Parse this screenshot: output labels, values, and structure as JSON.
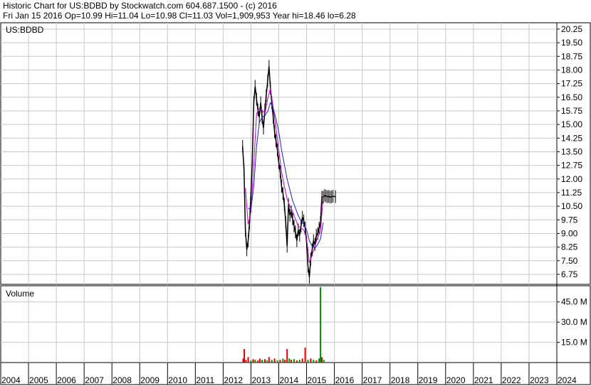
{
  "header": {
    "line1": "Historic Chart for US:BDBD by Stockwatch.com 604.687.1500 - (c) 2016",
    "line2": "Fri Jan 15 2016   Op=10.99   Hi=11.04   Lo=10.98   Cl=11.03   Vol=1,909,953   Year hi=18.46   lo=6.28"
  },
  "chart_data": [
    {
      "type": "line",
      "title": "US:BDBD",
      "y_ticks": [
        "20.25",
        "19.50",
        "18.75",
        "18.00",
        "17.25",
        "16.50",
        "15.75",
        "15.00",
        "14.25",
        "13.50",
        "12.75",
        "12.00",
        "11.25",
        "10.50",
        "9.75",
        "9.00",
        "8.25",
        "7.50",
        "6.75"
      ],
      "ylim": [
        6.2,
        20.6
      ],
      "x_ticks": [
        "2004",
        "2005",
        "2006",
        "2007",
        "2008",
        "2009",
        "2010",
        "2011",
        "2012",
        "2013",
        "2014",
        "2015",
        "2016",
        "2017",
        "2018",
        "2019",
        "2020",
        "2021",
        "2022",
        "2023",
        "2024"
      ],
      "xlim": [
        2004,
        2024
      ],
      "grid": true,
      "series": [
        {
          "style": "price",
          "color": "#000000",
          "x": [
            2012.7,
            2012.75,
            2012.8,
            2012.85,
            2012.9,
            2012.95,
            2013.0,
            2013.05,
            2013.1,
            2013.15,
            2013.2,
            2013.25,
            2013.3,
            2013.35,
            2013.4,
            2013.45,
            2013.5,
            2013.55,
            2013.6,
            2013.65,
            2013.7,
            2013.75,
            2013.8,
            2013.85,
            2013.9,
            2013.95,
            2014.0,
            2014.05,
            2014.1,
            2014.15,
            2014.2,
            2014.25,
            2014.3,
            2014.35,
            2014.4,
            2014.45,
            2014.5,
            2014.55,
            2014.6,
            2014.65,
            2014.7,
            2014.75,
            2014.8,
            2014.85,
            2014.9,
            2014.95,
            2015.0,
            2015.05,
            2015.1,
            2015.15,
            2015.2,
            2015.25,
            2015.3,
            2015.35,
            2015.4,
            2015.45,
            2015.5,
            2015.55,
            2015.6,
            2015.65,
            2015.7,
            2015.75,
            2015.8,
            2015.85,
            2015.9,
            2015.95,
            2016.04
          ],
          "values": [
            13.8,
            12.5,
            9.2,
            8.1,
            8.6,
            9.6,
            11.2,
            13.1,
            16.2,
            17.1,
            16.4,
            15.8,
            15.4,
            16.2,
            15.4,
            14.8,
            15.8,
            16.6,
            17.4,
            18.2,
            17.0,
            16.2,
            15.4,
            14.6,
            14.1,
            13.6,
            12.9,
            12.4,
            11.6,
            11.2,
            10.6,
            9.6,
            8.3,
            10.6,
            10.0,
            10.2,
            9.8,
            9.4,
            9.1,
            8.6,
            9.2,
            8.9,
            9.4,
            9.9,
            9.7,
            9.3,
            8.5,
            7.2,
            6.6,
            7.6,
            8.1,
            8.6,
            8.4,
            8.9,
            9.0,
            9.3,
            9.6,
            11.0,
            11.0,
            11.1,
            11.05,
            11.03,
            11.04,
            11.0,
            11.02,
            11.05,
            11.03
          ]
        },
        {
          "style": "moving-average",
          "color": "#c000c0",
          "x": [
            2012.8,
            2012.9,
            2013.0,
            2013.1,
            2013.2,
            2013.3,
            2013.4,
            2013.5,
            2013.6,
            2013.7,
            2013.8,
            2013.9,
            2014.0,
            2014.1,
            2014.2,
            2014.3,
            2014.4,
            2014.5,
            2014.6,
            2014.7,
            2014.8,
            2014.9,
            2015.0,
            2015.1,
            2015.2,
            2015.3,
            2015.4,
            2015.5,
            2015.6
          ],
          "values": [
            11.5,
            9.5,
            10.2,
            12.8,
            15.6,
            15.9,
            15.8,
            15.6,
            16.4,
            17.0,
            15.9,
            14.8,
            13.6,
            12.4,
            11.6,
            10.9,
            10.5,
            10.2,
            9.8,
            9.4,
            9.3,
            9.2,
            8.7,
            7.4,
            7.8,
            8.3,
            8.8,
            9.1,
            11.1
          ]
        },
        {
          "style": "moving-average",
          "color": "#2020d0",
          "x": [
            2012.9,
            2013.0,
            2013.1,
            2013.2,
            2013.3,
            2013.4,
            2013.5,
            2013.6,
            2013.7,
            2013.8,
            2013.9,
            2014.0,
            2014.1,
            2014.2,
            2014.3,
            2014.4,
            2014.5,
            2014.6,
            2014.7,
            2014.8,
            2014.9,
            2015.0,
            2015.1,
            2015.2,
            2015.3,
            2015.4,
            2015.5,
            2015.6
          ],
          "values": [
            10.4,
            10.3,
            11.6,
            13.8,
            15.1,
            15.4,
            15.5,
            15.7,
            16.2,
            15.9,
            15.3,
            14.6,
            13.6,
            12.8,
            12.0,
            11.4,
            10.8,
            10.4,
            10.0,
            9.7,
            9.5,
            9.2,
            8.6,
            8.3,
            8.2,
            8.4,
            8.7,
            9.6
          ]
        }
      ]
    },
    {
      "type": "bar",
      "title": "Volume",
      "y_ticks": [
        "45.0 M",
        "30.0 M",
        "15.0 M"
      ],
      "ylim": [
        0,
        57
      ],
      "grid": true,
      "bars": [
        {
          "x": 2012.72,
          "v": 3,
          "c": "#e00000"
        },
        {
          "x": 2012.76,
          "v": 10,
          "c": "#e00000"
        },
        {
          "x": 2012.82,
          "v": 2,
          "c": "#e00000"
        },
        {
          "x": 2012.9,
          "v": 4,
          "c": "#e00000"
        },
        {
          "x": 2013.0,
          "v": 1.5,
          "c": "#009000"
        },
        {
          "x": 2013.08,
          "v": 2.5,
          "c": "#e00000"
        },
        {
          "x": 2013.15,
          "v": 2,
          "c": "#009000"
        },
        {
          "x": 2013.25,
          "v": 1.5,
          "c": "#e00000"
        },
        {
          "x": 2013.32,
          "v": 3,
          "c": "#e00000"
        },
        {
          "x": 2013.4,
          "v": 2,
          "c": "#009000"
        },
        {
          "x": 2013.5,
          "v": 2.5,
          "c": "#e00000"
        },
        {
          "x": 2013.58,
          "v": 1.5,
          "c": "#009000"
        },
        {
          "x": 2013.65,
          "v": 4,
          "c": "#e00000"
        },
        {
          "x": 2013.75,
          "v": 2,
          "c": "#009000"
        },
        {
          "x": 2013.85,
          "v": 3,
          "c": "#e00000"
        },
        {
          "x": 2013.95,
          "v": 1.5,
          "c": "#009000"
        },
        {
          "x": 2014.05,
          "v": 2,
          "c": "#e00000"
        },
        {
          "x": 2014.15,
          "v": 3,
          "c": "#009000"
        },
        {
          "x": 2014.22,
          "v": 2,
          "c": "#e00000"
        },
        {
          "x": 2014.3,
          "v": 10,
          "c": "#e00000"
        },
        {
          "x": 2014.38,
          "v": 3,
          "c": "#009000"
        },
        {
          "x": 2014.45,
          "v": 2,
          "c": "#e00000"
        },
        {
          "x": 2014.55,
          "v": 2.5,
          "c": "#009000"
        },
        {
          "x": 2014.65,
          "v": 1.5,
          "c": "#e00000"
        },
        {
          "x": 2014.75,
          "v": 2,
          "c": "#009000"
        },
        {
          "x": 2014.85,
          "v": 3,
          "c": "#e00000"
        },
        {
          "x": 2014.95,
          "v": 11,
          "c": "#e00000"
        },
        {
          "x": 2015.05,
          "v": 2,
          "c": "#009000"
        },
        {
          "x": 2015.15,
          "v": 3,
          "c": "#e00000"
        },
        {
          "x": 2015.25,
          "v": 2,
          "c": "#009000"
        },
        {
          "x": 2015.35,
          "v": 1.5,
          "c": "#e00000"
        },
        {
          "x": 2015.45,
          "v": 3,
          "c": "#009000"
        },
        {
          "x": 2015.5,
          "v": 56,
          "c": "#009000"
        },
        {
          "x": 2015.55,
          "v": 4,
          "c": "#e00000"
        },
        {
          "x": 2015.62,
          "v": 2,
          "c": "#009000"
        }
      ]
    }
  ]
}
